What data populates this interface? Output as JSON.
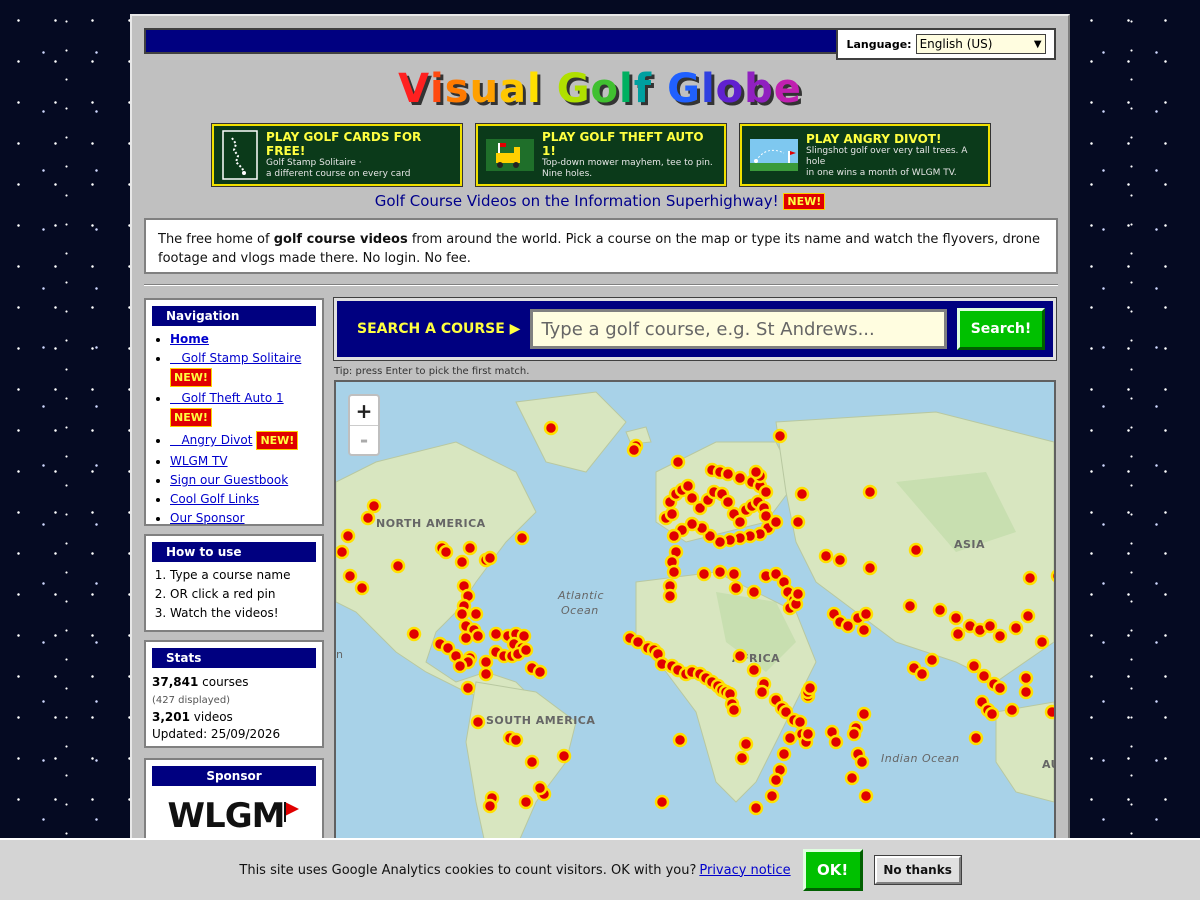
{
  "language": {
    "label": "Language:",
    "selected": "English (US)"
  },
  "logo": {
    "letters": [
      {
        "ch": "V",
        "color": "#ff2020"
      },
      {
        "ch": "i",
        "color": "#ff4a10"
      },
      {
        "ch": "s",
        "color": "#ff7a00"
      },
      {
        "ch": "u",
        "color": "#ffa000"
      },
      {
        "ch": "a",
        "color": "#ffc800"
      },
      {
        "ch": "l",
        "color": "#ffe000"
      },
      {
        "ch": " ",
        "color": "#000"
      },
      {
        "ch": "G",
        "color": "#b0e000"
      },
      {
        "ch": "o",
        "color": "#40c030"
      },
      {
        "ch": "l",
        "color": "#00b060"
      },
      {
        "ch": "f",
        "color": "#00a0a0"
      },
      {
        "ch": " ",
        "color": "#000"
      },
      {
        "ch": "G",
        "color": "#2060ff"
      },
      {
        "ch": "l",
        "color": "#3040e0"
      },
      {
        "ch": "o",
        "color": "#6020d0"
      },
      {
        "ch": "b",
        "color": "#9020c0"
      },
      {
        "ch": "e",
        "color": "#c020b0"
      }
    ]
  },
  "promos": [
    {
      "title": "PLAY GOLF CARDS FOR FREE!",
      "sub1": "Golf Stamp Solitaire ·",
      "sub2": "a different course on every card"
    },
    {
      "title": "PLAY GOLF THEFT AUTO 1!",
      "sub1": "Top-down mower mayhem, tee to pin.",
      "sub2": "Nine holes."
    },
    {
      "title": "PLAY ANGRY DIVOT!",
      "sub1": "Slingshot golf over very tall trees. A hole",
      "sub2": "in one wins a month of WLGM TV."
    }
  ],
  "tagline": {
    "text": "Golf Course Videos on the Information Superhighway!",
    "badge": "NEW!"
  },
  "intro": {
    "pre": "The free home of ",
    "bold": "golf course videos",
    "post": " from around the world. Pick a course on the map or type its name and watch the flyovers, drone footage and vlogs made there. No login. No fee."
  },
  "navigation": {
    "title": "Navigation",
    "items": [
      {
        "label": "Home",
        "bold": true,
        "new": false
      },
      {
        "label": "Golf Stamp Solitaire",
        "new": true
      },
      {
        "label": "Golf Theft Auto 1",
        "new": true
      },
      {
        "label": "Angry Divot",
        "new": true
      },
      {
        "label": "WLGM TV",
        "new": false
      },
      {
        "label": "Sign our Guestbook",
        "new": false
      },
      {
        "label": "Cool Golf Links",
        "new": false
      },
      {
        "label": "Our Sponsor",
        "new": false
      }
    ],
    "new_badge": "NEW!"
  },
  "howto": {
    "title": "How to use",
    "steps": [
      "Type a course name",
      "OR click a red pin",
      "Watch the videos!"
    ]
  },
  "stats": {
    "title": "Stats",
    "courses_count": "37,841",
    "courses_label": " courses",
    "displayed": "(427 displayed)",
    "videos_count": "3,201",
    "videos_label": " videos",
    "updated": "Updated: 25/09/2026"
  },
  "sponsor": {
    "title": "Sponsor",
    "logo_text": "WLGM"
  },
  "search": {
    "label": "SEARCH A COURSE ▶",
    "placeholder": "Type a golf course, e.g. St Andrews...",
    "button": "Search!",
    "tip": "Tip: press Enter to pick the first match."
  },
  "map": {
    "zoom_in": "+",
    "zoom_out": "-",
    "labels": [
      "NORTH AMERICA",
      "SOUTH AMERICA",
      "ASIA",
      "AFRICA",
      "Atlantic",
      "Ocean",
      "Indian Ocean",
      "AU",
      "n"
    ],
    "pin_color": "#e00000",
    "pin_ring": "#ffe000"
  },
  "cookie": {
    "text": "This site uses Google Analytics cookies to count visitors. OK with you?",
    "link": "Privacy notice",
    "ok": "OK!",
    "no": "No thanks"
  }
}
